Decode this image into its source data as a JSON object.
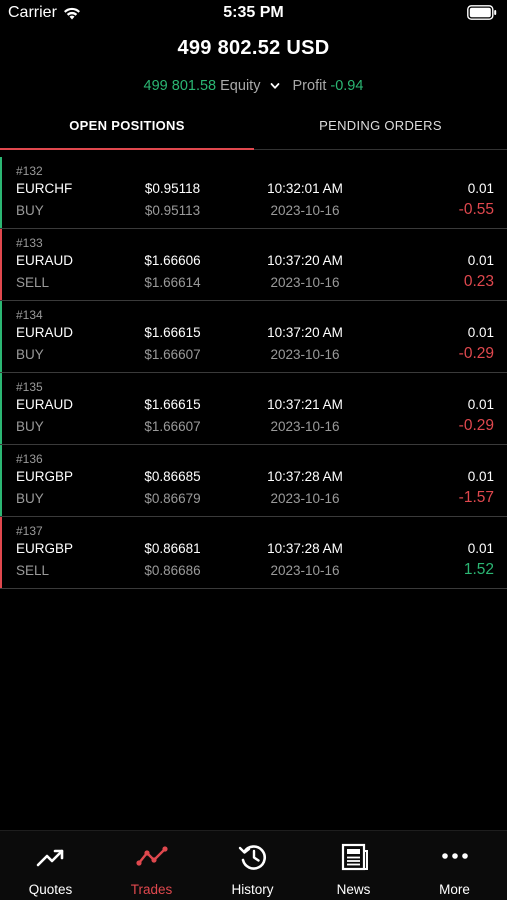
{
  "status_bar": {
    "carrier": "Carrier",
    "time": "5:35 PM"
  },
  "header": {
    "balance": "499 802.52 USD",
    "equity_value": "499 801.58",
    "equity_label": "Equity",
    "profit_label": "Profit",
    "profit_value": "-0.94"
  },
  "tabs": {
    "open_positions": "OPEN POSITIONS",
    "pending_orders": "PENDING ORDERS"
  },
  "colors": {
    "accent": "#e0484e",
    "positive": "#2bb673",
    "negative": "#e0484e"
  },
  "positions": [
    {
      "ticket": "#132",
      "symbol": "EURCHF",
      "side": "BUY",
      "open_price": "$0.95118",
      "current_price": "$0.95113",
      "time": "10:32:01 AM",
      "date": "2023-10-16",
      "volume": "0.01",
      "profit": "-0.55"
    },
    {
      "ticket": "#133",
      "symbol": "EURAUD",
      "side": "SELL",
      "open_price": "$1.66606",
      "current_price": "$1.66614",
      "time": "10:37:20 AM",
      "date": "2023-10-16",
      "volume": "0.01",
      "profit": "0.23"
    },
    {
      "ticket": "#134",
      "symbol": "EURAUD",
      "side": "BUY",
      "open_price": "$1.66615",
      "current_price": "$1.66607",
      "time": "10:37:20 AM",
      "date": "2023-10-16",
      "volume": "0.01",
      "profit": "-0.29"
    },
    {
      "ticket": "#135",
      "symbol": "EURAUD",
      "side": "BUY",
      "open_price": "$1.66615",
      "current_price": "$1.66607",
      "time": "10:37:21 AM",
      "date": "2023-10-16",
      "volume": "0.01",
      "profit": "-0.29"
    },
    {
      "ticket": "#136",
      "symbol": "EURGBP",
      "side": "BUY",
      "open_price": "$0.86685",
      "current_price": "$0.86679",
      "time": "10:37:28 AM",
      "date": "2023-10-16",
      "volume": "0.01",
      "profit": "-1.57"
    },
    {
      "ticket": "#137",
      "symbol": "EURGBP",
      "side": "SELL",
      "open_price": "$0.86681",
      "current_price": "$0.86686",
      "time": "10:37:28 AM",
      "date": "2023-10-16",
      "volume": "0.01",
      "profit": "1.52"
    }
  ],
  "tabbar": [
    {
      "label": "Quotes",
      "icon": "trend-up-icon"
    },
    {
      "label": "Trades",
      "icon": "trades-line-icon"
    },
    {
      "label": "History",
      "icon": "history-icon"
    },
    {
      "label": "News",
      "icon": "newspaper-icon"
    },
    {
      "label": "More",
      "icon": "more-dots-icon"
    }
  ]
}
